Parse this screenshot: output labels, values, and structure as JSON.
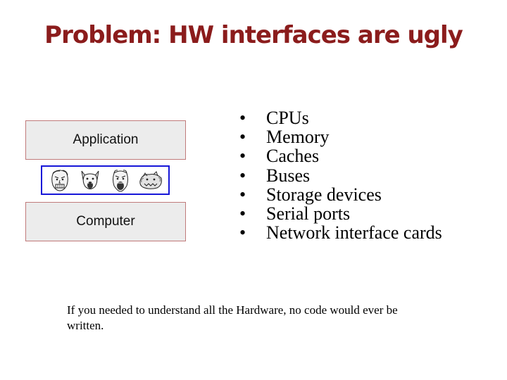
{
  "slide": {
    "title": "Problem: HW interfaces are ugly",
    "title_color": "#8b1c1c"
  },
  "diagram": {
    "top_box_label": "Application",
    "bottom_box_label": "Computer",
    "faces": [
      "grimacing-face-icon",
      "screaming-dog-face-icon",
      "screaming-face-icon",
      "growling-creature-icon"
    ],
    "strip_border_color": "#1616d8"
  },
  "bullets": {
    "marker": "•",
    "items": [
      "CPUs",
      "Memory",
      "Caches",
      "Buses",
      "Storage devices",
      "Serial ports",
      "Network interface cards"
    ]
  },
  "note": {
    "text": "If you needed to understand all the Hardware, no code would ever be written."
  }
}
